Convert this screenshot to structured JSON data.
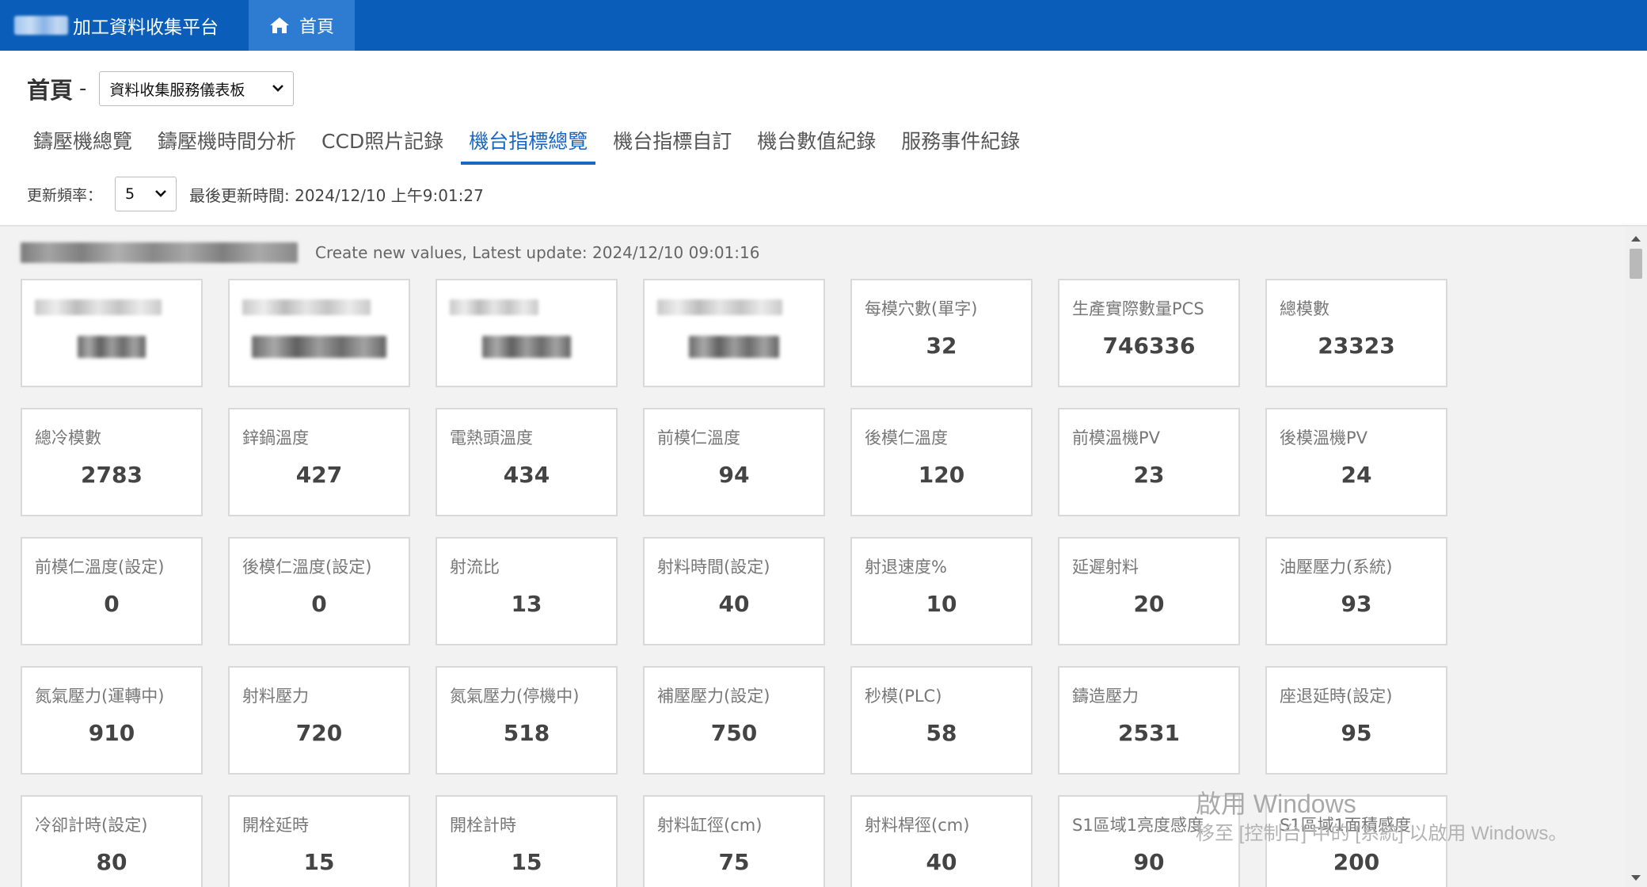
{
  "topbar": {
    "brand_title": "加工資料收集平台",
    "home_label": "首頁",
    "colors": {
      "nav_bg": "#0a5db8",
      "active_tab_bg": "#2e7cd1"
    }
  },
  "header": {
    "page_title": "首頁",
    "title_dash": "-",
    "dashboard_select_value": "資料收集服務儀表板",
    "tabs": [
      {
        "label": "鑄壓機總覽",
        "active": false
      },
      {
        "label": "鑄壓機時間分析",
        "active": false
      },
      {
        "label": "CCD照片記錄",
        "active": false
      },
      {
        "label": "機台指標總覽",
        "active": true
      },
      {
        "label": "機台指標自訂",
        "active": false
      },
      {
        "label": "機台數值紀錄",
        "active": false
      },
      {
        "label": "服務事件紀錄",
        "active": false
      }
    ],
    "refresh_label": "更新頻率：",
    "refresh_value": "5",
    "last_update_text": "最後更新時間: 2024/12/10 上午9:01:27",
    "accent_color": "#1a67c4"
  },
  "content": {
    "machine_meta": "Create new values, Latest update: 2024/12/10 09:01:16",
    "cards": [
      {
        "label": "",
        "value": "",
        "redacted": true
      },
      {
        "label": "",
        "value": "",
        "redacted": true
      },
      {
        "label": "",
        "value": "",
        "redacted": true
      },
      {
        "label": "",
        "value": "",
        "redacted": true
      },
      {
        "label": "每模穴數(單字)",
        "value": "32"
      },
      {
        "label": "生產實際數量PCS",
        "value": "746336"
      },
      {
        "label": "總模數",
        "value": "23323"
      },
      {
        "label": "總冷模數",
        "value": "2783"
      },
      {
        "label": "鋅鍋溫度",
        "value": "427"
      },
      {
        "label": "電熱頭溫度",
        "value": "434"
      },
      {
        "label": "前模仁溫度",
        "value": "94"
      },
      {
        "label": "後模仁溫度",
        "value": "120"
      },
      {
        "label": "前模溫機PV",
        "value": "23"
      },
      {
        "label": "後模溫機PV",
        "value": "24"
      },
      {
        "label": "前模仁溫度(設定)",
        "value": "0"
      },
      {
        "label": "後模仁溫度(設定)",
        "value": "0"
      },
      {
        "label": "射流比",
        "value": "13"
      },
      {
        "label": "射料時間(設定)",
        "value": "40"
      },
      {
        "label": "射退速度%",
        "value": "10"
      },
      {
        "label": "延遲射料",
        "value": "20"
      },
      {
        "label": "油壓壓力(系統)",
        "value": "93"
      },
      {
        "label": "氮氣壓力(運轉中)",
        "value": "910"
      },
      {
        "label": "射料壓力",
        "value": "720"
      },
      {
        "label": "氮氣壓力(停機中)",
        "value": "518"
      },
      {
        "label": "補壓壓力(設定)",
        "value": "750"
      },
      {
        "label": "秒模(PLC)",
        "value": "58"
      },
      {
        "label": "鑄造壓力",
        "value": "2531"
      },
      {
        "label": "座退延時(設定)",
        "value": "95"
      },
      {
        "label": "冷卻計時(設定)",
        "value": "80"
      },
      {
        "label": "開栓延時",
        "value": "15"
      },
      {
        "label": "開栓計時",
        "value": "15"
      },
      {
        "label": "射料缸徑(cm)",
        "value": "75"
      },
      {
        "label": "射料桿徑(cm)",
        "value": "40"
      },
      {
        "label": "S1區域1亮度感度",
        "value": "90"
      },
      {
        "label": "S1區域1面積感度",
        "value": "200"
      }
    ]
  },
  "watermark": {
    "line1": "啟用 Windows",
    "line2": "移至 [控制台] 中的 [系統] 以啟用 Windows。"
  }
}
